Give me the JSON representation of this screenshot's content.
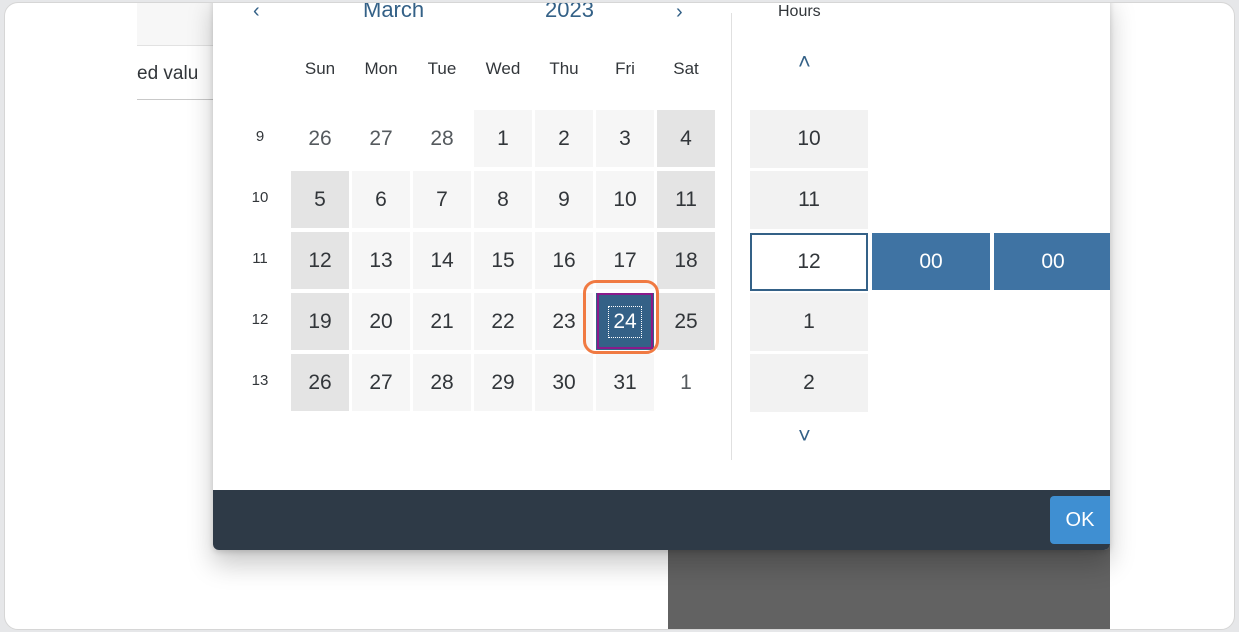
{
  "background": {
    "field_text": "ed valu"
  },
  "calendar": {
    "month": "March",
    "year": "2023",
    "prev_icon": "chevron-left-icon",
    "next_icon": "chevron-right-icon",
    "day_names": [
      "Sun",
      "Mon",
      "Tue",
      "Wed",
      "Thu",
      "Fri",
      "Sat"
    ],
    "weeks": [
      {
        "number": "9",
        "days": [
          "26",
          "27",
          "28",
          "1",
          "2",
          "3",
          "4"
        ]
      },
      {
        "number": "10",
        "days": [
          "5",
          "6",
          "7",
          "8",
          "9",
          "10",
          "11"
        ]
      },
      {
        "number": "11",
        "days": [
          "12",
          "13",
          "14",
          "15",
          "16",
          "17",
          "18"
        ]
      },
      {
        "number": "12",
        "days": [
          "19",
          "20",
          "21",
          "22",
          "23",
          "24",
          "25"
        ]
      },
      {
        "number": "13",
        "days": [
          "26",
          "27",
          "28",
          "29",
          "30",
          "31",
          "1"
        ]
      }
    ],
    "selected_day": "24"
  },
  "time": {
    "hours_label": "Hours",
    "up_icon": "chevron-up-icon",
    "down_icon": "chevron-down-icon",
    "hours": [
      "10",
      "11",
      "12",
      "1",
      "2"
    ],
    "selected_hour": "12",
    "minutes": "00",
    "seconds": "00"
  },
  "footer": {
    "ok_label": "OK"
  },
  "colors": {
    "accent": "#346187",
    "footer_bg": "#2e3a47",
    "ok_button": "#3f8fd2",
    "focus_ring": "#f07a42"
  }
}
